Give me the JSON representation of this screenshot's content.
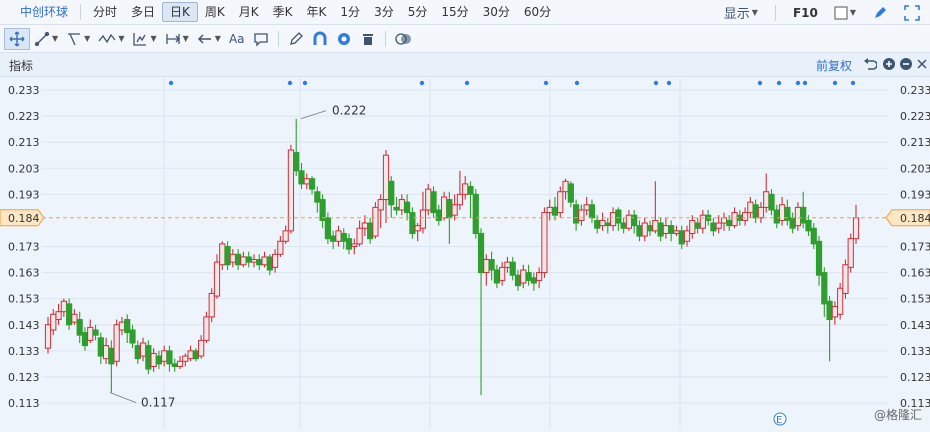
{
  "toolbar": {
    "stock_name": "中创环球",
    "periods": [
      "分时",
      "多日",
      "日K",
      "周K",
      "月K",
      "季K",
      "年K",
      "1分",
      "3分",
      "5分",
      "15分",
      "30分",
      "60分"
    ],
    "active_period": "日K",
    "display_label": "显示",
    "f10_label": "F10",
    "drawing_text_tool": "Aa"
  },
  "indicator_bar": {
    "label": "指标",
    "adjust_label": "前复权"
  },
  "chart_data": {
    "type": "candlestick",
    "ylim": [
      0.108,
      0.238
    ],
    "y_ticks": [
      "0.233",
      "0.223",
      "0.213",
      "0.203",
      "0.193",
      "0.184",
      "0.173",
      "0.163",
      "0.153",
      "0.143",
      "0.133",
      "0.123",
      "0.113"
    ],
    "current_price_label": "0.184",
    "current_price": 0.184,
    "high_annotation": "0.222",
    "low_annotation": "0.117",
    "marker_letter": "E",
    "up_color": "#c9313b",
    "down_color": "#2e9e2e",
    "candles": [
      [
        0.134,
        0.143,
        0.146,
        0.132
      ],
      [
        0.141,
        0.147,
        0.149,
        0.139
      ],
      [
        0.145,
        0.148,
        0.151,
        0.143
      ],
      [
        0.148,
        0.152,
        0.153,
        0.146
      ],
      [
        0.151,
        0.143,
        0.153,
        0.141
      ],
      [
        0.144,
        0.147,
        0.149,
        0.143
      ],
      [
        0.145,
        0.139,
        0.148,
        0.136
      ],
      [
        0.14,
        0.135,
        0.142,
        0.133
      ],
      [
        0.137,
        0.142,
        0.145,
        0.136
      ],
      [
        0.141,
        0.139,
        0.143,
        0.137
      ],
      [
        0.138,
        0.131,
        0.14,
        0.128
      ],
      [
        0.13,
        0.135,
        0.138,
        0.128
      ],
      [
        0.134,
        0.128,
        0.137,
        0.117
      ],
      [
        0.129,
        0.143,
        0.145,
        0.127
      ],
      [
        0.141,
        0.144,
        0.146,
        0.139
      ],
      [
        0.145,
        0.14,
        0.147,
        0.136
      ],
      [
        0.141,
        0.136,
        0.143,
        0.134
      ],
      [
        0.135,
        0.13,
        0.137,
        0.128
      ],
      [
        0.131,
        0.136,
        0.138,
        0.129
      ],
      [
        0.135,
        0.126,
        0.137,
        0.124
      ],
      [
        0.127,
        0.132,
        0.134,
        0.125
      ],
      [
        0.131,
        0.128,
        0.133,
        0.126
      ],
      [
        0.129,
        0.133,
        0.135,
        0.127
      ],
      [
        0.133,
        0.128,
        0.135,
        0.125
      ],
      [
        0.128,
        0.127,
        0.13,
        0.125
      ],
      [
        0.127,
        0.129,
        0.131,
        0.126
      ],
      [
        0.129,
        0.131,
        0.132,
        0.127
      ],
      [
        0.13,
        0.133,
        0.135,
        0.129
      ],
      [
        0.133,
        0.13,
        0.134,
        0.129
      ],
      [
        0.131,
        0.137,
        0.139,
        0.13
      ],
      [
        0.137,
        0.146,
        0.148,
        0.136
      ],
      [
        0.146,
        0.155,
        0.157,
        0.144
      ],
      [
        0.154,
        0.167,
        0.17,
        0.153
      ],
      [
        0.166,
        0.174,
        0.175,
        0.164
      ],
      [
        0.173,
        0.166,
        0.175,
        0.164
      ],
      [
        0.167,
        0.17,
        0.172,
        0.165
      ],
      [
        0.17,
        0.166,
        0.172,
        0.164
      ],
      [
        0.166,
        0.169,
        0.171,
        0.165
      ],
      [
        0.169,
        0.167,
        0.171,
        0.165
      ],
      [
        0.167,
        0.168,
        0.17,
        0.165
      ],
      [
        0.168,
        0.166,
        0.17,
        0.164
      ],
      [
        0.166,
        0.169,
        0.171,
        0.165
      ],
      [
        0.169,
        0.164,
        0.17,
        0.162
      ],
      [
        0.165,
        0.17,
        0.172,
        0.163
      ],
      [
        0.17,
        0.175,
        0.177,
        0.169
      ],
      [
        0.175,
        0.179,
        0.181,
        0.174
      ],
      [
        0.179,
        0.21,
        0.212,
        0.178
      ],
      [
        0.209,
        0.202,
        0.222,
        0.2
      ],
      [
        0.202,
        0.197,
        0.205,
        0.195
      ],
      [
        0.197,
        0.199,
        0.201,
        0.195
      ],
      [
        0.199,
        0.195,
        0.2,
        0.193
      ],
      [
        0.194,
        0.19,
        0.196,
        0.186
      ],
      [
        0.191,
        0.183,
        0.193,
        0.18
      ],
      [
        0.184,
        0.176,
        0.186,
        0.174
      ],
      [
        0.177,
        0.175,
        0.179,
        0.172
      ],
      [
        0.175,
        0.179,
        0.181,
        0.173
      ],
      [
        0.178,
        0.175,
        0.18,
        0.172
      ],
      [
        0.176,
        0.172,
        0.178,
        0.17
      ],
      [
        0.173,
        0.174,
        0.176,
        0.17
      ],
      [
        0.174,
        0.18,
        0.183,
        0.173
      ],
      [
        0.18,
        0.182,
        0.185,
        0.177
      ],
      [
        0.182,
        0.176,
        0.184,
        0.174
      ],
      [
        0.177,
        0.188,
        0.19,
        0.176
      ],
      [
        0.187,
        0.191,
        0.193,
        0.18
      ],
      [
        0.191,
        0.208,
        0.21,
        0.182
      ],
      [
        0.198,
        0.189,
        0.2,
        0.184
      ],
      [
        0.188,
        0.187,
        0.192,
        0.185
      ],
      [
        0.187,
        0.191,
        0.193,
        0.185
      ],
      [
        0.19,
        0.186,
        0.193,
        0.183
      ],
      [
        0.186,
        0.178,
        0.188,
        0.176
      ],
      [
        0.179,
        0.181,
        0.182,
        0.175
      ],
      [
        0.18,
        0.187,
        0.194,
        0.178
      ],
      [
        0.187,
        0.195,
        0.197,
        0.185
      ],
      [
        0.194,
        0.186,
        0.196,
        0.184
      ],
      [
        0.187,
        0.183,
        0.189,
        0.181
      ],
      [
        0.184,
        0.192,
        0.194,
        0.183
      ],
      [
        0.191,
        0.184,
        0.194,
        0.174
      ],
      [
        0.185,
        0.189,
        0.193,
        0.183
      ],
      [
        0.189,
        0.193,
        0.202,
        0.187
      ],
      [
        0.193,
        0.197,
        0.2,
        0.191
      ],
      [
        0.196,
        0.193,
        0.198,
        0.184
      ],
      [
        0.193,
        0.178,
        0.195,
        0.176
      ],
      [
        0.178,
        0.163,
        0.18,
        0.116
      ],
      [
        0.163,
        0.168,
        0.17,
        0.158
      ],
      [
        0.168,
        0.164,
        0.171,
        0.16
      ],
      [
        0.164,
        0.159,
        0.166,
        0.157
      ],
      [
        0.16,
        0.165,
        0.167,
        0.158
      ],
      [
        0.165,
        0.167,
        0.169,
        0.163
      ],
      [
        0.167,
        0.162,
        0.169,
        0.16
      ],
      [
        0.162,
        0.158,
        0.164,
        0.156
      ],
      [
        0.159,
        0.164,
        0.166,
        0.157
      ],
      [
        0.163,
        0.16,
        0.166,
        0.158
      ],
      [
        0.161,
        0.159,
        0.163,
        0.156
      ],
      [
        0.16,
        0.163,
        0.165,
        0.157
      ],
      [
        0.163,
        0.186,
        0.188,
        0.161
      ],
      [
        0.186,
        0.188,
        0.191,
        0.183
      ],
      [
        0.188,
        0.185,
        0.192,
        0.183
      ],
      [
        0.186,
        0.194,
        0.196,
        0.184
      ],
      [
        0.194,
        0.198,
        0.199,
        0.191
      ],
      [
        0.197,
        0.19,
        0.198,
        0.188
      ],
      [
        0.189,
        0.182,
        0.191,
        0.179
      ],
      [
        0.183,
        0.187,
        0.189,
        0.181
      ],
      [
        0.187,
        0.189,
        0.192,
        0.185
      ],
      [
        0.189,
        0.184,
        0.191,
        0.182
      ],
      [
        0.183,
        0.18,
        0.185,
        0.178
      ],
      [
        0.181,
        0.183,
        0.186,
        0.179
      ],
      [
        0.182,
        0.181,
        0.184,
        0.178
      ],
      [
        0.181,
        0.186,
        0.188,
        0.179
      ],
      [
        0.187,
        0.182,
        0.188,
        0.179
      ],
      [
        0.182,
        0.18,
        0.184,
        0.178
      ],
      [
        0.18,
        0.185,
        0.187,
        0.179
      ],
      [
        0.185,
        0.181,
        0.187,
        0.178
      ],
      [
        0.181,
        0.177,
        0.183,
        0.175
      ],
      [
        0.177,
        0.182,
        0.184,
        0.175
      ],
      [
        0.181,
        0.179,
        0.183,
        0.177
      ],
      [
        0.179,
        0.183,
        0.198,
        0.178
      ],
      [
        0.182,
        0.177,
        0.184,
        0.175
      ],
      [
        0.178,
        0.181,
        0.184,
        0.176
      ],
      [
        0.181,
        0.178,
        0.183,
        0.175
      ],
      [
        0.178,
        0.179,
        0.181,
        0.177
      ],
      [
        0.179,
        0.174,
        0.181,
        0.172
      ],
      [
        0.175,
        0.179,
        0.181,
        0.173
      ],
      [
        0.178,
        0.183,
        0.185,
        0.176
      ],
      [
        0.182,
        0.18,
        0.184,
        0.178
      ],
      [
        0.18,
        0.185,
        0.187,
        0.178
      ],
      [
        0.185,
        0.183,
        0.187,
        0.181
      ],
      [
        0.182,
        0.179,
        0.184,
        0.177
      ],
      [
        0.18,
        0.182,
        0.185,
        0.178
      ],
      [
        0.182,
        0.184,
        0.186,
        0.179
      ],
      [
        0.183,
        0.181,
        0.185,
        0.179
      ],
      [
        0.181,
        0.186,
        0.188,
        0.18
      ],
      [
        0.185,
        0.183,
        0.187,
        0.181
      ],
      [
        0.183,
        0.186,
        0.188,
        0.181
      ],
      [
        0.186,
        0.19,
        0.192,
        0.184
      ],
      [
        0.189,
        0.184,
        0.191,
        0.182
      ],
      [
        0.184,
        0.188,
        0.19,
        0.182
      ],
      [
        0.188,
        0.194,
        0.201,
        0.186
      ],
      [
        0.193,
        0.187,
        0.195,
        0.185
      ],
      [
        0.187,
        0.182,
        0.189,
        0.18
      ],
      [
        0.183,
        0.189,
        0.192,
        0.181
      ],
      [
        0.188,
        0.183,
        0.191,
        0.181
      ],
      [
        0.184,
        0.18,
        0.186,
        0.178
      ],
      [
        0.181,
        0.188,
        0.19,
        0.179
      ],
      [
        0.188,
        0.182,
        0.194,
        0.18
      ],
      [
        0.183,
        0.179,
        0.185,
        0.177
      ],
      [
        0.18,
        0.174,
        0.182,
        0.172
      ],
      [
        0.175,
        0.162,
        0.177,
        0.158
      ],
      [
        0.163,
        0.151,
        0.165,
        0.146
      ],
      [
        0.152,
        0.145,
        0.154,
        0.129
      ],
      [
        0.146,
        0.15,
        0.152,
        0.143
      ],
      [
        0.147,
        0.157,
        0.159,
        0.145
      ],
      [
        0.155,
        0.166,
        0.168,
        0.153
      ],
      [
        0.165,
        0.176,
        0.178,
        0.163
      ],
      [
        0.176,
        0.184,
        0.189,
        0.174
      ]
    ],
    "event_marker_candles": [
      10,
      21,
      25,
      43,
      48,
      54,
      57,
      61,
      72,
      76,
      78,
      80,
      83,
      86,
      94,
      102
    ]
  }
}
